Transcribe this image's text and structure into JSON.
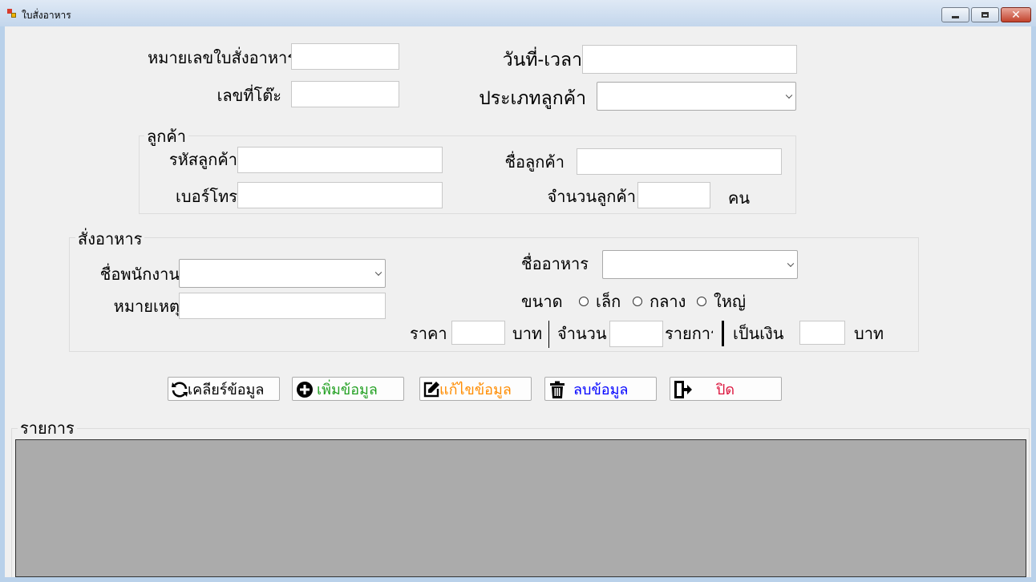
{
  "window": {
    "title": "ใบสั่งอาหาร"
  },
  "header": {
    "order_no_label": "หมายเลขใบสั่งอาหาร",
    "datetime_label": "วันที่-เวลา",
    "table_no_label": "เลขที่โต๊ะ",
    "customer_type_label": "ประเภทลูกค้า",
    "order_no_value": "",
    "datetime_value": "",
    "table_no_value": "",
    "customer_type_value": ""
  },
  "customer": {
    "group_label": "ลูกค้า",
    "id_label": "รหัสลูกค้า",
    "name_label": "ชื่อลูกค้า",
    "phone_label": "เบอร์โทร",
    "count_label": "จำนวนลูกค้า",
    "count_unit": "คน",
    "id_value": "",
    "name_value": "",
    "phone_value": "",
    "count_value": ""
  },
  "order": {
    "group_label": "สั่งอาหาร",
    "employee_label": "ชื่อพนักงาน",
    "note_label": "หมายเหตุ",
    "food_label": "ชื่ออาหาร",
    "size_label": "ขนาด",
    "size_options": [
      "เล็ก",
      "กลาง",
      "ใหญ่"
    ],
    "price_label": "ราคา",
    "price_unit": "บาท",
    "qty_label": "จำนวน",
    "qty_unit": "รายการ",
    "total_label": "เป็นเงิน",
    "total_unit": "บาท",
    "employee_value": "",
    "note_value": "",
    "food_value": "",
    "price_value": "",
    "qty_value": "",
    "total_value": ""
  },
  "buttons": {
    "clear": "เคลียร์ข้อมูล",
    "add": "เพิ่มข้อมูล",
    "edit": "แก้ไขข้อมูล",
    "delete": "ลบข้อมูล",
    "close": "ปิด"
  },
  "list": {
    "group_label": "รายการ"
  },
  "colors": {
    "add_text": "#22a022",
    "edit_text": "#ff8c00",
    "delete_text": "#0000ff",
    "close_text": "#dc143c",
    "grid_bg": "#ababab"
  },
  "icons": {
    "clear": "refresh-icon",
    "add": "plus-circle-icon",
    "edit": "edit-icon",
    "delete": "trash-icon",
    "close": "exit-icon"
  }
}
